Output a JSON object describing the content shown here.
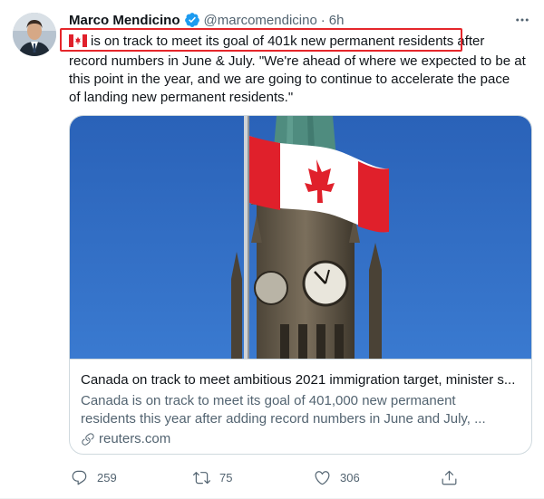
{
  "tweet": {
    "display_name": "Marco Mendicino",
    "handle": "@marcomendicino",
    "separator": "·",
    "time": "6h",
    "text_line1": "is on track to meet its goal of 401k new permanent residents after",
    "text_line2": "record numbers in June & July. \"We're ahead of where we expected to be at",
    "text_line3": "this point in the year, and we are going to continue to accelerate the pace",
    "text_line4": "of landing new permanent residents.\""
  },
  "card": {
    "title": "Canada on track to meet ambitious 2021 immigration target, minister s...",
    "description_line1": "Canada is on track to meet its goal of 401,000 new permanent",
    "description_line2": "residents this year after adding record numbers in June and July, ...",
    "domain": "reuters.com"
  },
  "actions": {
    "replies": "259",
    "retweets": "75",
    "likes": "306"
  },
  "colors": {
    "accent": "#1d9bf0",
    "highlight_box": "#e5262b",
    "muted_text": "#536471",
    "sky": "#2f6cc2",
    "flag_red": "#e0202b"
  },
  "icons": [
    "verified-badge-icon",
    "more-options-icon",
    "canada-flag-emoji",
    "link-icon",
    "reply-icon",
    "retweet-icon",
    "like-icon",
    "share-icon"
  ]
}
